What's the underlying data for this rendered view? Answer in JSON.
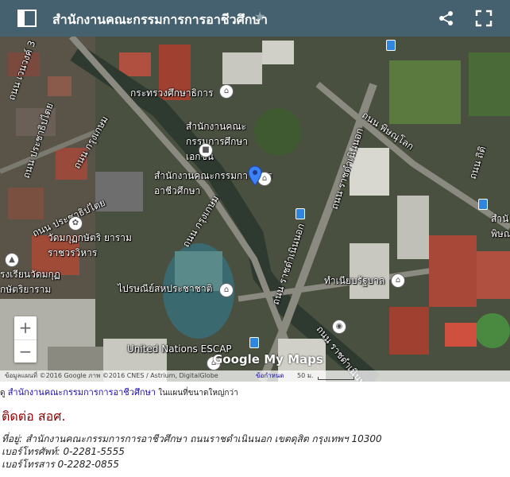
{
  "header": {
    "title": "สำนักงานคณะกรรมการการอาชีวศึกษา",
    "menu_icon": "sidebar-menu-icon",
    "star_icon": "star-icon",
    "share_icon": "share-icon",
    "fullscreen_icon": "fullscreen-icon",
    "background": "#45606e"
  },
  "map": {
    "labels": {
      "road_top_left": "ถนน เวนวงค์ 3",
      "road_left1": "ถนน ประชาธิปไตย",
      "road_left2": "ถนน ประชาธิปไตย",
      "ministry": "กระทรวงศึกษาธิการ",
      "private_edu": "สำนักงานคณะ กรรมการศึกษาเอกชน",
      "vocational": "สำนักงานคณะกรรมการ การอาชีวศึกษา",
      "krung_kasem1": "ถนน กรุงเกษม",
      "krung_kasem2": "ถนน กรุงเกษม",
      "ratchadamnoen1": "ถนน ราชดำเนินนอก",
      "ratchadamnoen2": "ถนน ราชดำเนินนอก",
      "ratchadamnoen3": "ถนน ราชดำเนินนอก",
      "phitsanulok": "ถนน พิษณุโลก",
      "road_right": "ถนน ถิติ",
      "temple": "วัดมกุฏกษัตริ ยาราม ราชวรวิหาร",
      "school": "รงเรียนวัดมกุฏ กษัตริยาราม",
      "post_museum": "ไปรษณีย์สหประชาชาติ",
      "gov_house": "ทำเนียบรัฐบาล",
      "right_edge": "สำนั พิษณ",
      "escap": "United Nations ESCAP"
    },
    "zoom_in": "+",
    "zoom_out": "−",
    "logo": "Google My Maps",
    "attribution": "ข้อมูลแผนที่ ©2016 Google ภาพ ©2016 CNES / Astrium, DigitalGlobe",
    "terms": "ข้อกำหนด",
    "scale": "50 ม."
  },
  "caption": {
    "prefix": "ดู",
    "link": "สำนักงานคณะกรรมการการอาชีวศึกษา",
    "suffix": "ในแผนที่ขนาดใหญ่กว่า"
  },
  "contact": {
    "title": "ติดต่อ สอศ.",
    "address": "ที่อยู่: สำนักงานคณะกรรมการการอาชีวศึกษา ถนนราชดำเนินนอก เขตดุสิต กรุงเทพฯ 10300",
    "phone": "เบอร์โทรศัพท์: 0-2281-5555",
    "fax": "เบอร์โทรสาร 0-2282-0855"
  }
}
